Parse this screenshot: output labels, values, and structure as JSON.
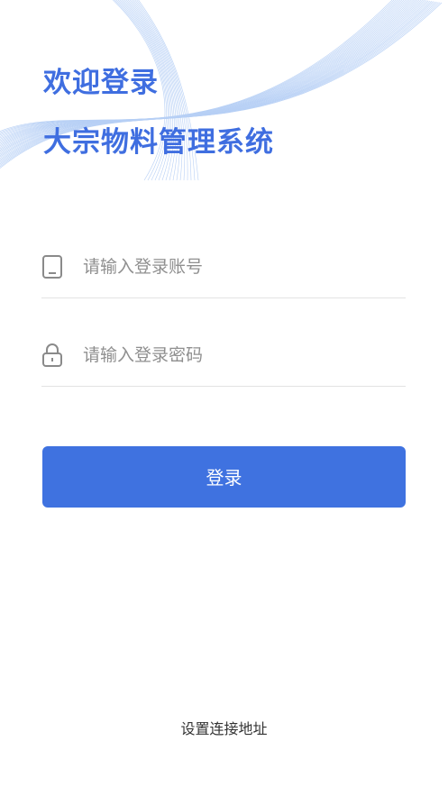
{
  "header": {
    "welcome": "欢迎登录",
    "system_name": "大宗物料管理系统"
  },
  "form": {
    "account_placeholder": "请输入登录账号",
    "account_value": "",
    "password_placeholder": "请输入登录密码",
    "password_value": "",
    "account_icon": "phone-icon",
    "password_icon": "lock-icon"
  },
  "actions": {
    "login_label": "登录",
    "settings_link": "设置连接地址"
  },
  "colors": {
    "accent": "#3f72e0",
    "title": "#3f6ee0"
  }
}
